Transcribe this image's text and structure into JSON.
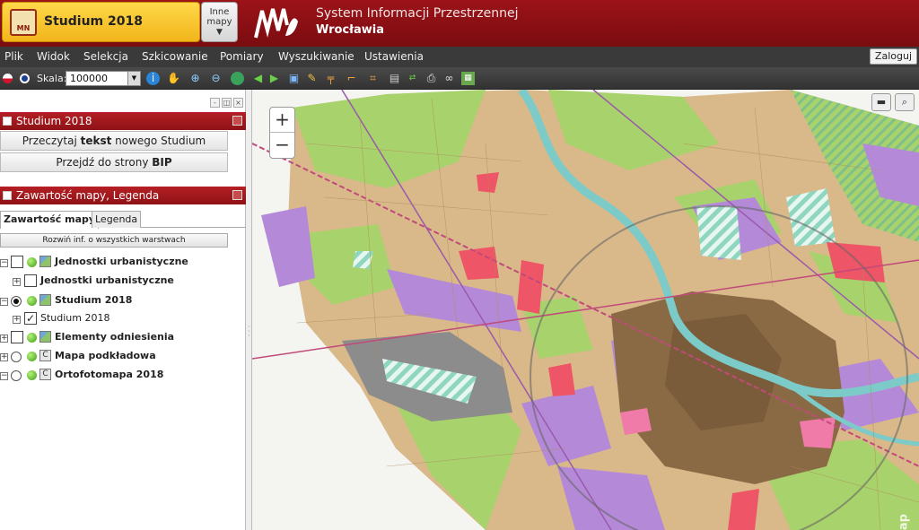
{
  "header": {
    "app_title": "Studium 2018",
    "logo_text": "MN",
    "other_maps_label_line1": "Inne",
    "other_maps_label_line2": "mapy",
    "system_title_line1": "System Informacji Przestrzennej",
    "system_title_line2": "Wrocławia"
  },
  "menu": {
    "items": [
      "Plik",
      "Widok",
      "Selekcja",
      "Szkicowanie",
      "Pomiary",
      "Wyszukiwanie",
      "Ustawienia"
    ],
    "login_label": "Zaloguj"
  },
  "toolbar": {
    "scale_label": "Skala:",
    "scale_value": "100000",
    "tools": [
      "info-icon",
      "pan-hand-icon",
      "zoom-in-icon",
      "zoom-out-icon",
      "globe-icon",
      "back-arrow-icon",
      "forward-arrow-icon",
      "extent-icon",
      "pencil-icon",
      "measure-length-icon",
      "measure-angle-icon",
      "crop-icon",
      "clipboard-icon",
      "wfs-icon",
      "print-icon",
      "link-icon",
      "export-icon"
    ]
  },
  "left_panel": {
    "studium_section": {
      "title": "Studium 2018",
      "button1_pre": "Przeczytaj ",
      "button1_bold": "tekst",
      "button1_post": " nowego Studium",
      "button2_pre": "Przejdź do strony ",
      "button2_bold": "BIP"
    },
    "legend_section": {
      "title": "Zawartość mapy, Legenda",
      "tab_contents": "Zawartość mapy",
      "tab_legend": "Legenda",
      "expand_all_label": "Rozwiń inf. o wszystkich warstwach"
    },
    "layers": [
      {
        "label": "Jednostki urbanistyczne",
        "bold": true
      },
      {
        "label": "Jednostki urbanistyczne",
        "bold": true
      },
      {
        "label": "Studium 2018",
        "bold": true
      },
      {
        "label": "Studium 2018",
        "bold": false
      },
      {
        "label": "Elementy odniesienia",
        "bold": true
      },
      {
        "label": "Mapa podkładowa",
        "bold": true
      },
      {
        "label": "Ortofotomapa 2018",
        "bold": true
      }
    ]
  },
  "map": {
    "zoom_in_label": "+",
    "zoom_out_label": "−",
    "watermark": "iMap"
  },
  "colors": {
    "header_red": "#8e1216",
    "accent_yellow": "#f2b51a",
    "city_center_brown": "#8a6a45",
    "residential_tan": "#d9b88a",
    "green_area": "#a8d26c",
    "industrial_purple": "#b48ad8",
    "service_red": "#ee5566"
  }
}
